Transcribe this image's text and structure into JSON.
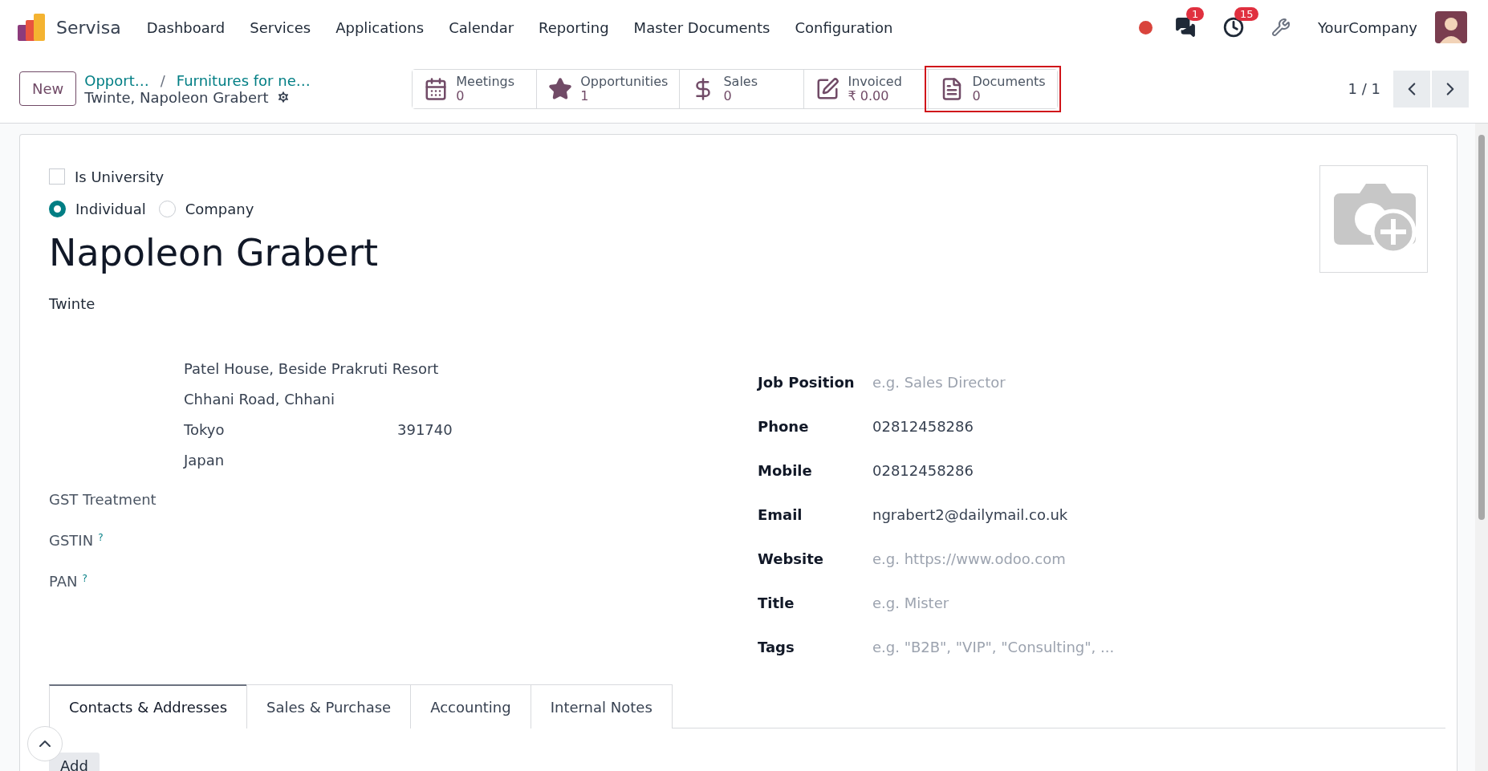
{
  "navbar": {
    "brand": "Servisa",
    "menu": [
      "Dashboard",
      "Services",
      "Applications",
      "Calendar",
      "Reporting",
      "Master Documents",
      "Configuration"
    ],
    "status_dot": {
      "color": "#d9443c"
    },
    "chat_badge": "1",
    "activity_badge": "15",
    "company": "YourCompany"
  },
  "control_panel": {
    "new_button": "New",
    "breadcrumbs": [
      "Opport…",
      "Furnitures for ne…"
    ],
    "breadcrumb_separator": "/",
    "record_name": "Twinte, Napoleon Grabert",
    "smart_buttons": [
      {
        "kind": "calendar",
        "label": "Meetings",
        "value": "0",
        "highlighted": false
      },
      {
        "kind": "star",
        "label": "Opportunities",
        "value": "1",
        "highlighted": false
      },
      {
        "kind": "dollar",
        "label": "Sales",
        "value": "0",
        "highlighted": false
      },
      {
        "kind": "edit",
        "label": "Invoiced",
        "value": "₹ 0.00",
        "highlighted": false
      },
      {
        "kind": "document",
        "label": "Documents",
        "value": "0",
        "highlighted": true
      }
    ],
    "pager": "1 / 1"
  },
  "form": {
    "is_university": {
      "label": "Is University",
      "checked": false
    },
    "company_type": [
      {
        "label": "Individual",
        "selected": true
      },
      {
        "label": "Company",
        "selected": false
      }
    ],
    "name": "Napoleon Grabert",
    "company_name": "Twinte",
    "address": {
      "street": "Patel House, Beside Prakruti Resort",
      "street2": "Chhani Road, Chhani",
      "city": "Tokyo",
      "zip": "391740",
      "country": "Japan"
    },
    "left_fields": [
      {
        "label": "GST Treatment"
      },
      {
        "label": "GSTIN",
        "help": "?"
      },
      {
        "label": "PAN",
        "help": "?"
      }
    ],
    "right_fields": [
      {
        "label": "Job Position",
        "placeholder": "e.g. Sales Director"
      },
      {
        "label": "Phone",
        "value": "02812458286"
      },
      {
        "label": "Mobile",
        "value": "02812458286"
      },
      {
        "label": "Email",
        "value": "ngrabert2@dailymail.co.uk"
      },
      {
        "label": "Website",
        "placeholder": "e.g. https://www.odoo.com"
      },
      {
        "label": "Title",
        "placeholder": "e.g. Mister"
      },
      {
        "label": "Tags",
        "placeholder": "e.g. \"B2B\", \"VIP\", \"Consulting\", ..."
      }
    ],
    "tabs": [
      {
        "label": "Contacts & Addresses",
        "selected": true
      },
      {
        "label": "Sales & Purchase",
        "selected": false
      },
      {
        "label": "Accounting",
        "selected": false
      },
      {
        "label": "Internal Notes",
        "selected": false
      }
    ],
    "add_button": "Add"
  }
}
